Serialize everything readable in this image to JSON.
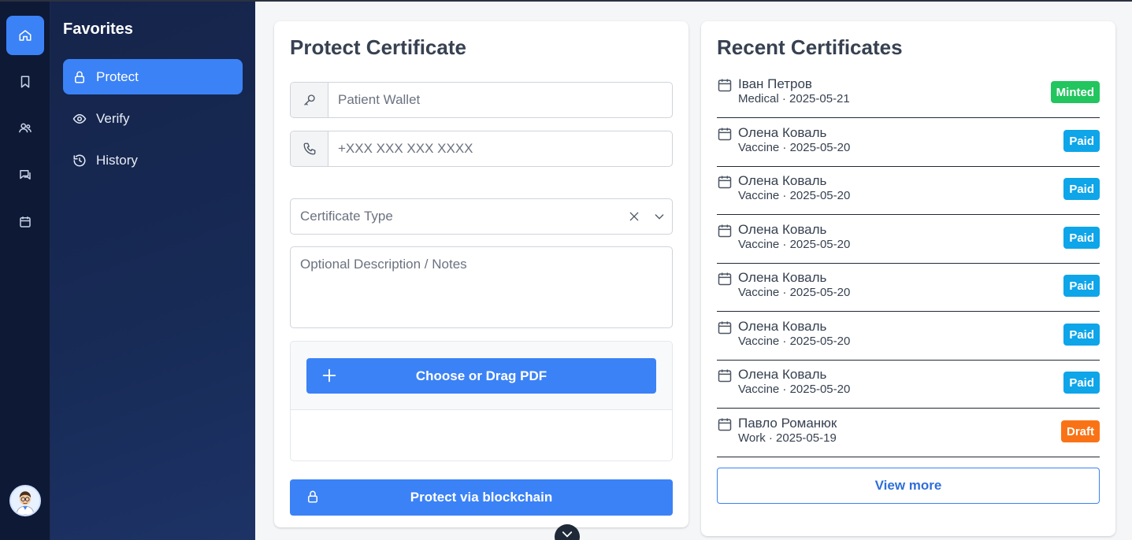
{
  "rail": {
    "items": [
      "home-icon",
      "bookmark-icon",
      "users-icon",
      "chat-icon",
      "calendar-icon"
    ],
    "active": "home-icon",
    "accent": "#3b82f6"
  },
  "favorites": {
    "title": "Favorites",
    "items": [
      {
        "label": "Protect",
        "icon": "lock-icon",
        "active": true
      },
      {
        "label": "Verify",
        "icon": "eye-icon",
        "active": false
      },
      {
        "label": "History",
        "icon": "history-icon",
        "active": false
      }
    ]
  },
  "protect": {
    "title": "Protect Certificate",
    "wallet_placeholder": "Patient Wallet",
    "phone_placeholder": "+XXX XXX XXX XXXX",
    "type_placeholder": "Certificate Type",
    "notes_placeholder": "Optional Description / Notes",
    "upload_label": "Choose or Drag PDF",
    "submit_label": "Protect via blockchain"
  },
  "recent": {
    "title": "Recent Certificates",
    "items": [
      {
        "name": "Іван Петров",
        "meta": "Medical · 2025-05-21",
        "status": "Minted",
        "color": "#22c55e"
      },
      {
        "name": "Олена Коваль",
        "meta": "Vaccine · 2025-05-20",
        "status": "Paid",
        "color": "#0ea5e9"
      },
      {
        "name": "Олена Коваль",
        "meta": "Vaccine · 2025-05-20",
        "status": "Paid",
        "color": "#0ea5e9"
      },
      {
        "name": "Олена Коваль",
        "meta": "Vaccine · 2025-05-20",
        "status": "Paid",
        "color": "#0ea5e9"
      },
      {
        "name": "Олена Коваль",
        "meta": "Vaccine · 2025-05-20",
        "status": "Paid",
        "color": "#0ea5e9"
      },
      {
        "name": "Олена Коваль",
        "meta": "Vaccine · 2025-05-20",
        "status": "Paid",
        "color": "#0ea5e9"
      },
      {
        "name": "Олена Коваль",
        "meta": "Vaccine · 2025-05-20",
        "status": "Paid",
        "color": "#0ea5e9"
      },
      {
        "name": "Павло Романюк",
        "meta": "Work · 2025-05-19",
        "status": "Draft",
        "color": "#f97316"
      }
    ],
    "view_more_label": "View more"
  }
}
